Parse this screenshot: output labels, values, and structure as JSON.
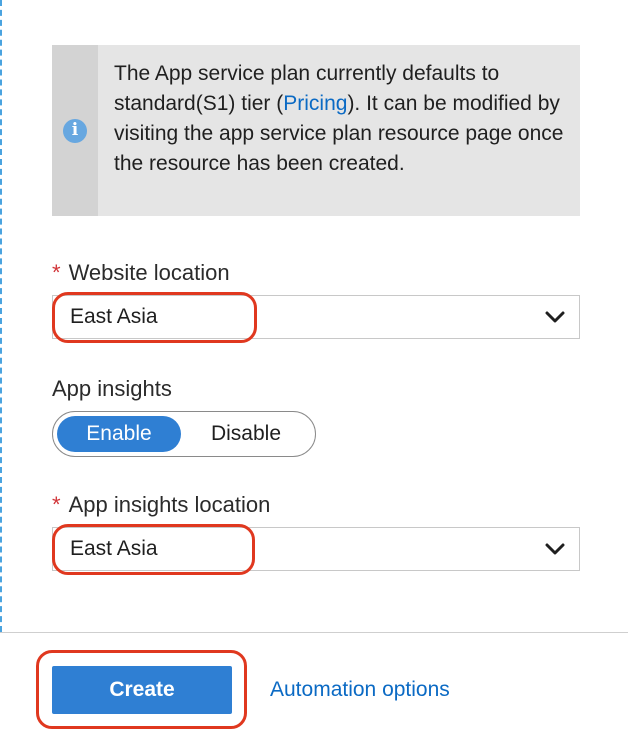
{
  "info_banner": {
    "icon": "info-icon",
    "text_before_link": "The App service plan currently defaults to standard(S1) tier (",
    "link_label": "Pricing",
    "text_after_link": "). It can be modified by visiting the app service plan resource page once the resource has been created."
  },
  "website_location": {
    "required_marker": "*",
    "label": "Website location",
    "value": "East Asia"
  },
  "app_insights": {
    "label": "App insights",
    "options": [
      "Enable",
      "Disable"
    ],
    "selected": "Enable"
  },
  "app_insights_location": {
    "required_marker": "*",
    "label": "App insights location",
    "value": "East Asia"
  },
  "footer": {
    "create_label": "Create",
    "automation_label": "Automation options"
  },
  "colors": {
    "accent": "#2f7fd3",
    "link": "#0b6ac4",
    "required": "#d13438",
    "highlight": "#e0381f",
    "banner_bg": "#e5e5e5"
  }
}
